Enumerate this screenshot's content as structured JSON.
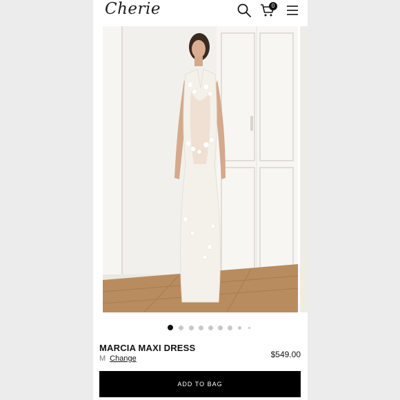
{
  "header": {
    "logo": "Cherie",
    "cart_count": "0",
    "icons": [
      "search-icon",
      "cart-icon",
      "menu-icon"
    ]
  },
  "gallery": {
    "image_count": 9,
    "active_index": 0
  },
  "product": {
    "name": "MARCIA MAXI DRESS",
    "size_value": "M",
    "size_change_label": "Change",
    "price": "$549.00"
  },
  "actions": {
    "add_to_bag_label": "ADD TO BAG"
  },
  "colors": {
    "button_bg": "#000000",
    "button_text": "#ffffff"
  }
}
